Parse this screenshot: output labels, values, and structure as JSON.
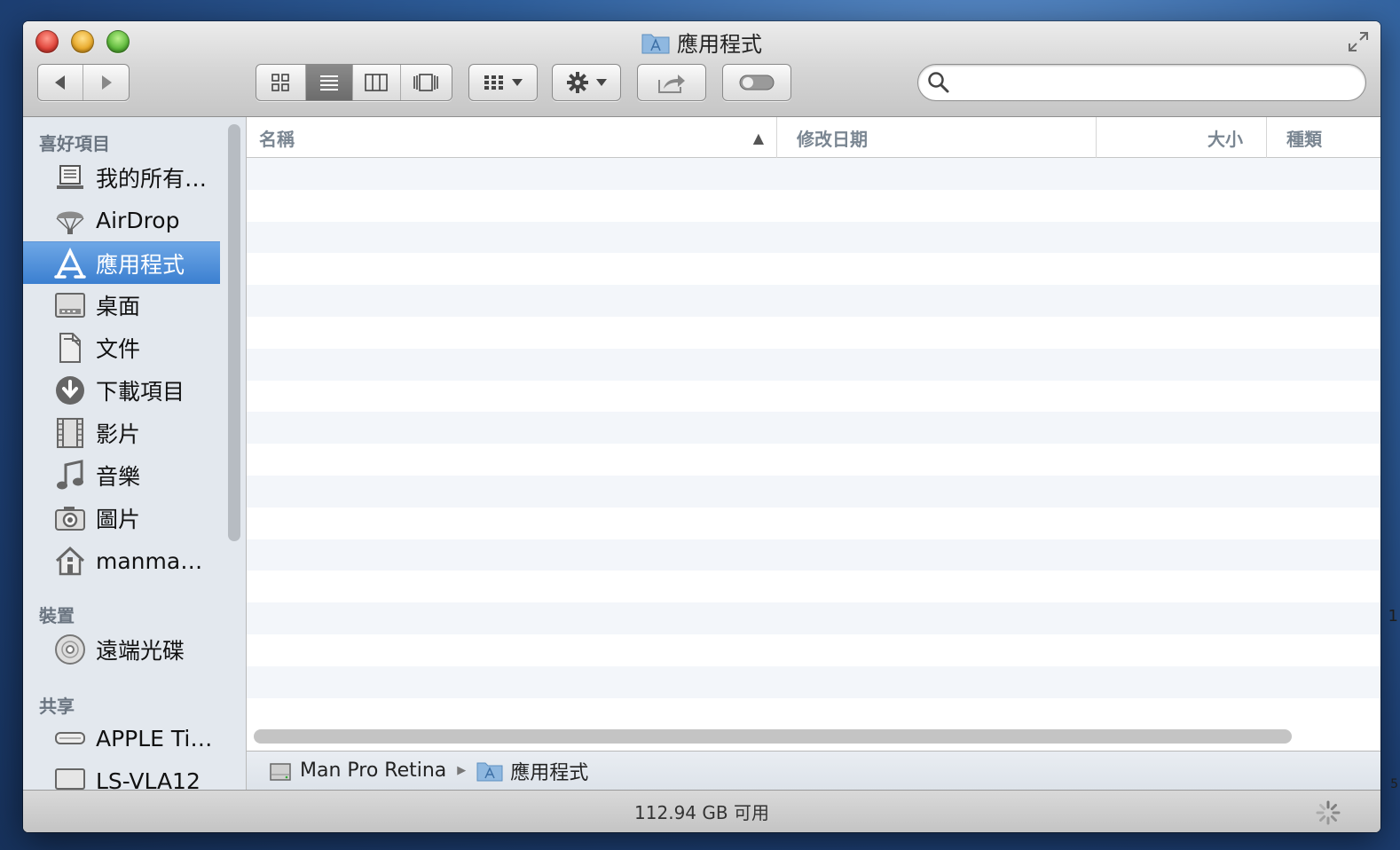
{
  "window": {
    "title": "應用程式"
  },
  "toolbar": {
    "back_icon": "left-arrow-icon",
    "forward_icon": "right-arrow-icon",
    "view_modes": [
      "icon-view",
      "list-view",
      "column-view",
      "coverflow-view"
    ],
    "active_view": "list-view",
    "arrange_icon": "arrange-grid-icon",
    "action_icon": "gear-icon",
    "share_icon": "share-icon",
    "tag_icon": "tag-toggle-icon"
  },
  "search": {
    "value": "",
    "placeholder": ""
  },
  "sidebar": {
    "favorites_title": "喜好項目",
    "favorites": [
      {
        "label": "我的所有…",
        "icon": "all-my-files-icon"
      },
      {
        "label": "AirDrop",
        "icon": "airdrop-icon"
      },
      {
        "label": "應用程式",
        "icon": "applications-icon",
        "selected": true
      },
      {
        "label": "桌面",
        "icon": "desktop-icon"
      },
      {
        "label": "文件",
        "icon": "documents-icon"
      },
      {
        "label": "下載項目",
        "icon": "downloads-icon"
      },
      {
        "label": "影片",
        "icon": "movies-icon"
      },
      {
        "label": "音樂",
        "icon": "music-icon"
      },
      {
        "label": "圖片",
        "icon": "pictures-icon"
      },
      {
        "label": "manma…",
        "icon": "home-icon"
      }
    ],
    "devices_title": "裝置",
    "devices": [
      {
        "label": "遠端光碟",
        "icon": "remote-disc-icon"
      }
    ],
    "shared_title": "共享",
    "shared": [
      {
        "label": "APPLE Ti…",
        "icon": "time-capsule-icon"
      },
      {
        "label": "LS-VLA12",
        "icon": "network-computer-icon"
      }
    ]
  },
  "columns": {
    "name": "名稱",
    "date_modified": "修改日期",
    "size": "大小",
    "kind": "種類",
    "sort_indicator": "▲"
  },
  "pathbar": {
    "disk": "Man Pro Retina",
    "separator": "▶",
    "folder": "應用程式"
  },
  "status": {
    "free_space": "112.94 GB 可用"
  },
  "desktop": {
    "edge_text_1": "1",
    "edge_text_2": "5"
  },
  "colors": {
    "selection": "#3b7fd0",
    "sidebar_bg": "#e3e8ee",
    "row_stripe": "#f3f6fa"
  }
}
